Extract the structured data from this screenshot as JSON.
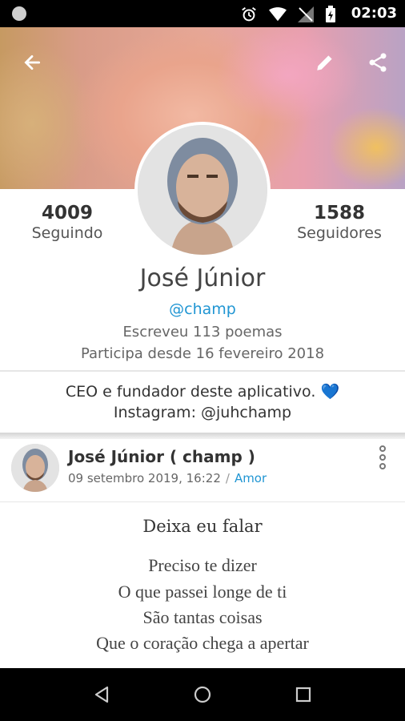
{
  "status_bar": {
    "time": "02:03",
    "icons": [
      "notification-dot-icon",
      "alarm-icon",
      "wifi-icon",
      "no-signal-icon",
      "battery-charging-icon"
    ]
  },
  "cover": {
    "back_icon": "arrow-back-icon",
    "edit_icon": "edit-pencil-icon",
    "share_icon": "share-icon"
  },
  "profile": {
    "following_count": "4009",
    "following_label": "Seguindo",
    "followers_count": "1588",
    "followers_label": "Seguidores",
    "name": "José Júnior",
    "handle": "@champ",
    "poems_written": "Escreveu 113 poemas",
    "member_since": "Participa desde 16 fevereiro 2018",
    "bio_line1": "CEO e fundador deste aplicativo.",
    "bio_emoji": "💙",
    "bio_line2": "Instagram: @juhchamp"
  },
  "post": {
    "author": "José Júnior ( champ )",
    "date": "09 setembro 2019, 16:22",
    "separator": "/",
    "category": "Amor",
    "title": "Deixa eu falar",
    "lines": [
      "Preciso te dizer",
      "O que passei longe de ti",
      "São tantas coisas",
      "Que o coração chega a apertar"
    ]
  },
  "colors": {
    "accent": "#2196d3",
    "text_dark": "#333333",
    "text_muted": "#666666"
  }
}
